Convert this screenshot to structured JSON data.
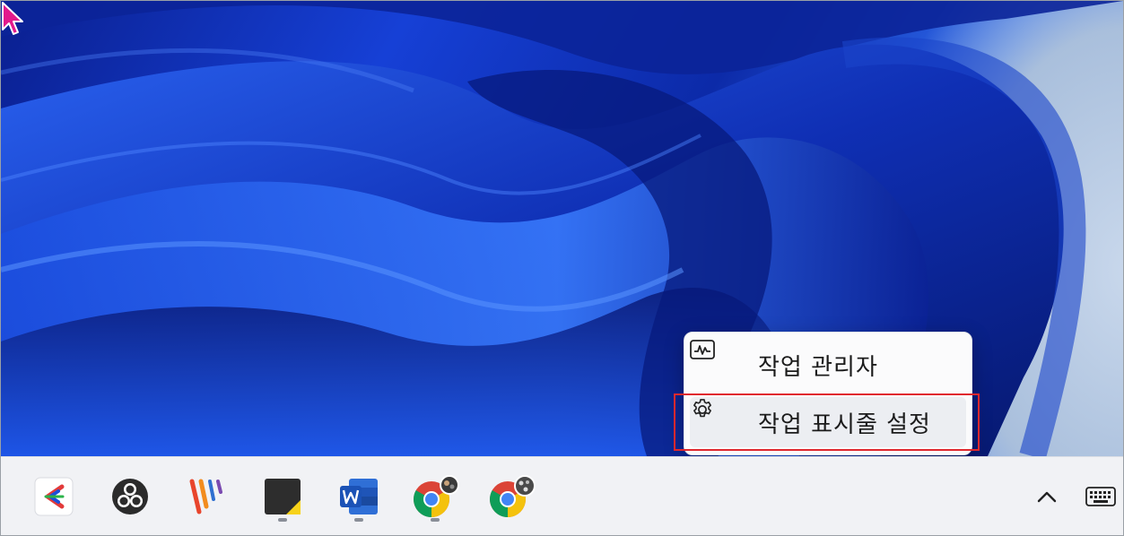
{
  "context_menu": {
    "items": [
      {
        "label": "작업 관리자",
        "icon": "task-manager-icon"
      },
      {
        "label": "작업 표시줄 설정",
        "icon": "gear-icon",
        "hovered": true
      }
    ]
  },
  "taskbar": {
    "apps": [
      {
        "icon": "ezpdf-app-icon",
        "running": false
      },
      {
        "icon": "obs-studio-icon",
        "running": false
      },
      {
        "icon": "colorful-stripes-app-icon",
        "running": false
      },
      {
        "icon": "sticky-notes-icon",
        "running": true
      },
      {
        "icon": "word-icon",
        "running": true
      },
      {
        "icon": "chrome-profile-1-icon",
        "running": true
      },
      {
        "icon": "chrome-profile-2-icon",
        "running": false
      }
    ],
    "tray": [
      {
        "icon": "chevron-up-icon"
      },
      {
        "icon": "keyboard-icon"
      }
    ]
  },
  "colors": {
    "highlight": "#e0282e",
    "cursor": "#e21a8c"
  }
}
